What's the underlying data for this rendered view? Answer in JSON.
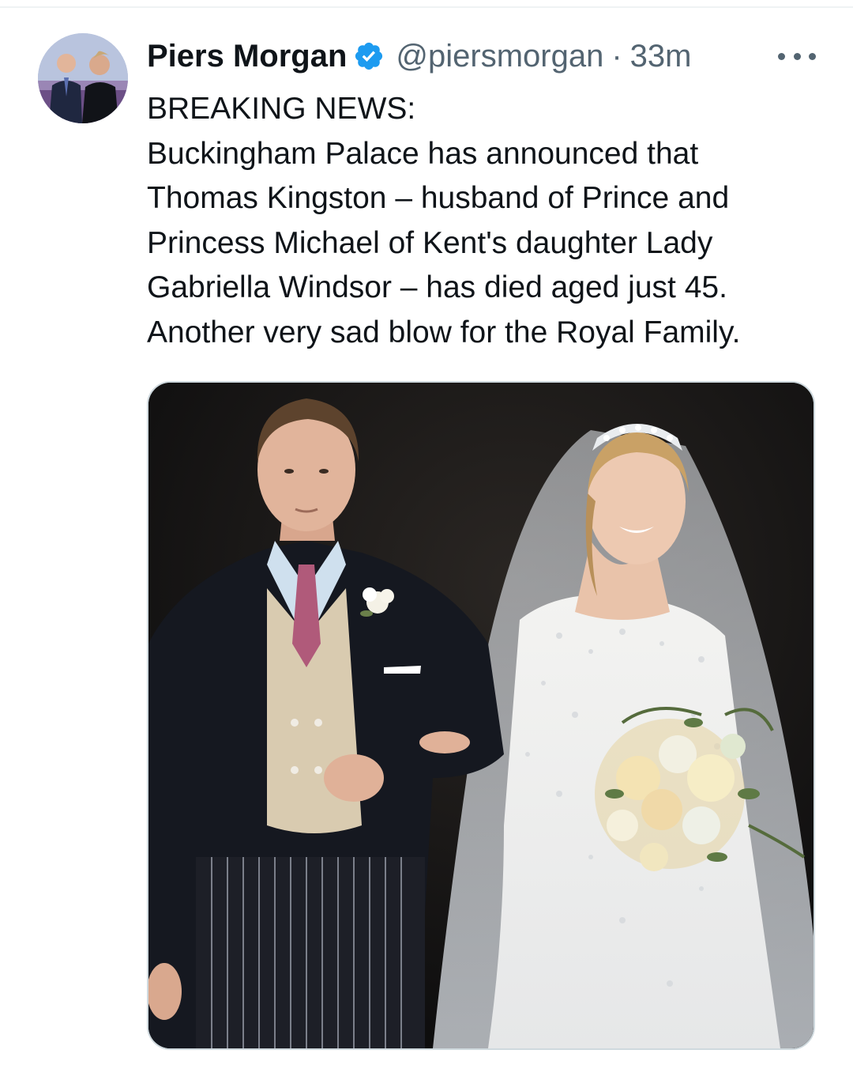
{
  "tweet": {
    "author": {
      "name": "Piers Morgan",
      "handle": "@piersmorgan",
      "verified": true,
      "avatar_icon": "avatar-photo"
    },
    "separator": "·",
    "time": "33m",
    "more_icon": "more-options-icon",
    "text_lines": [
      "BREAKING NEWS:",
      "Buckingham Palace has announced that",
      "Thomas Kingston – husband of Prince and",
      "Princess Michael of Kent's daughter Lady",
      "Gabriella Windsor – has died aged just 45.",
      "Another very sad blow for the Royal Family."
    ],
    "media": {
      "kind": "photo"
    }
  },
  "colors": {
    "text_primary": "#0f1419",
    "text_secondary": "#536471",
    "verified_badge": "#1d9bf0",
    "media_border": "#cfd9de"
  }
}
